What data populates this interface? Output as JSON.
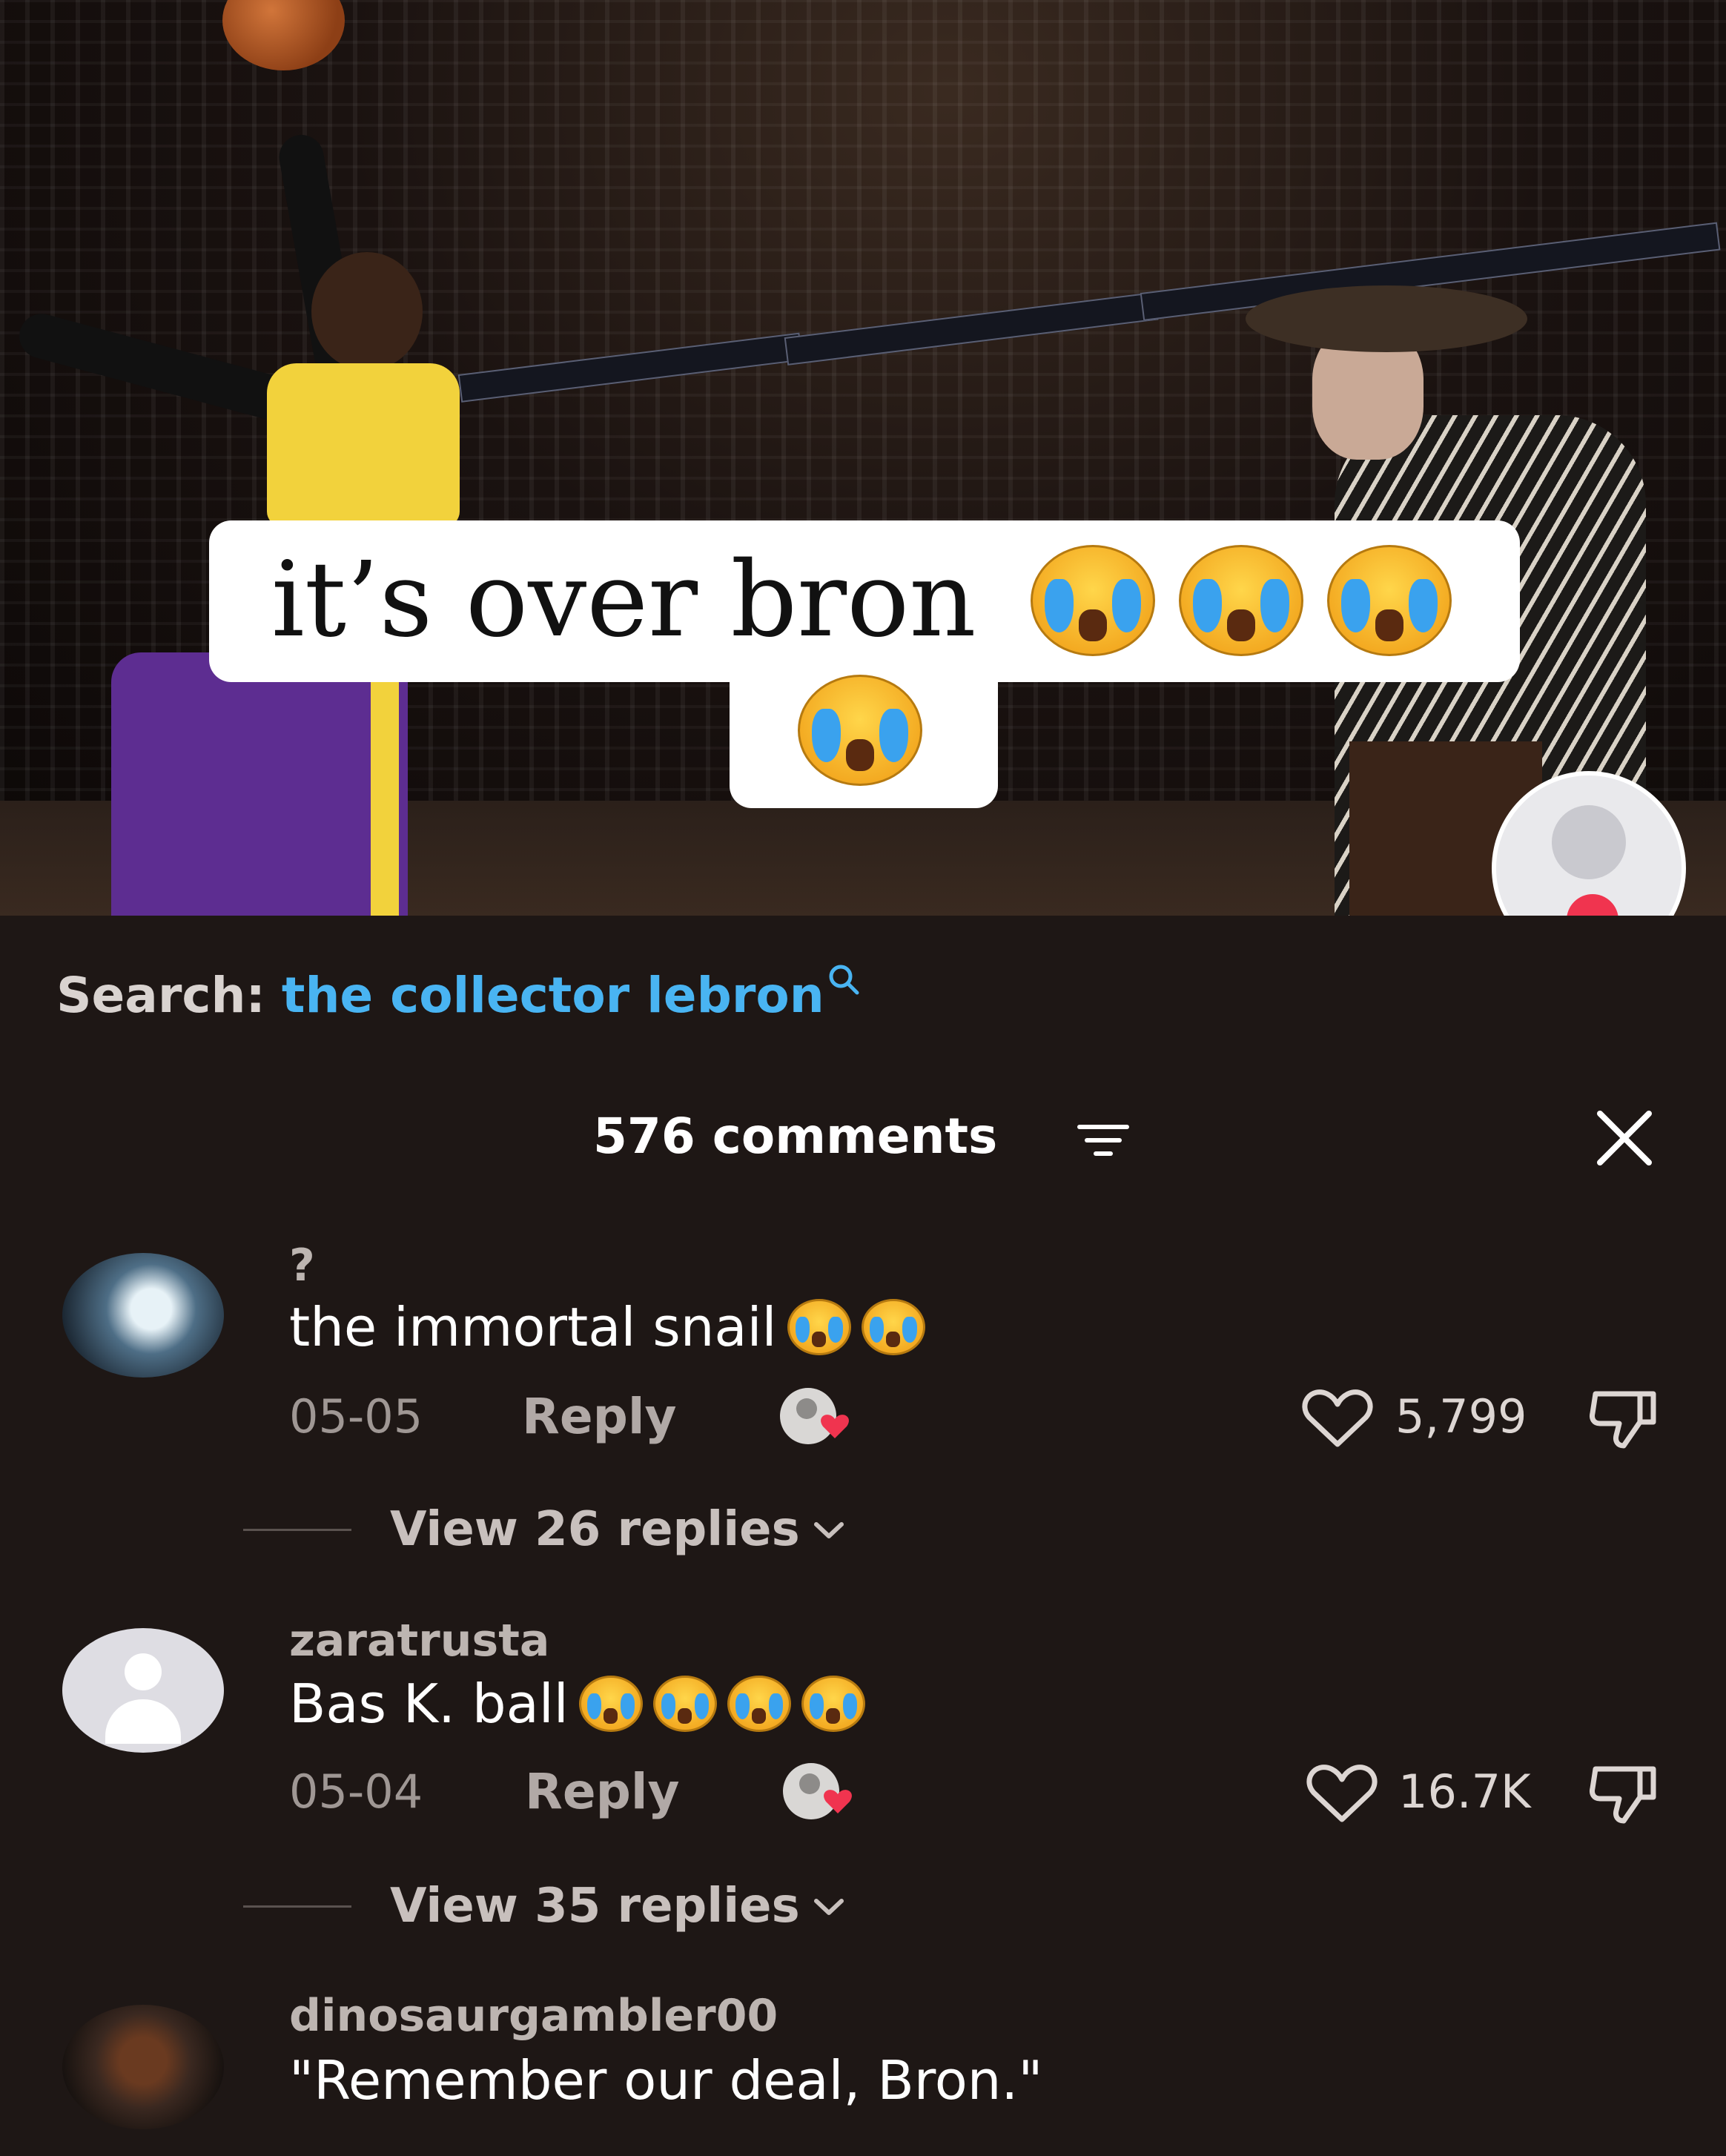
{
  "video": {
    "caption": "it’s over bron",
    "caption_emojis": [
      "crying-face",
      "crying-face",
      "crying-face",
      "crying-face"
    ]
  },
  "search": {
    "label": "Search:",
    "term": "the collector lebron"
  },
  "comments_header": {
    "title": "576 comments"
  },
  "comments": [
    {
      "username": "?",
      "text": "the immortal snail",
      "emoji_count": 2,
      "date": "05-05",
      "reply_label": "Reply",
      "likes": "5,799",
      "view_replies": "View 26 replies"
    },
    {
      "username": "zaratrusta",
      "text": "Bas K. ball",
      "emoji_count": 4,
      "date": "05-04",
      "reply_label": "Reply",
      "likes": "16.7K",
      "view_replies": "View 35 replies"
    },
    {
      "username": "dinosaurgambler00",
      "text": "\"Remember our deal, Bron.\""
    }
  ],
  "colors": {
    "sheet_background": "#1e1715",
    "search_term": "#49b4f2",
    "like_badge": "#f0344f"
  }
}
